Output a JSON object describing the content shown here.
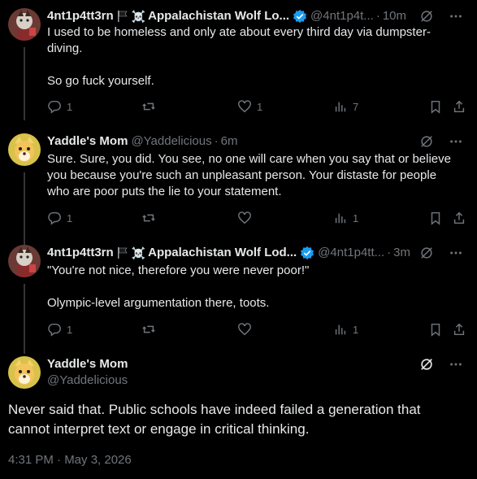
{
  "tweets": [
    {
      "name": "4nt1p4tt3rn",
      "emoji": "🏴‍☠️",
      "display_suffix": "Appalachistan Wolf Lo...",
      "handle": "@4nt1p4t...",
      "time": "10m",
      "lines": [
        "I used to be homeless and only ate about every third day via dumpster-",
        "diving.",
        "",
        "So go fuck yourself."
      ],
      "replies": "1",
      "retweets": "",
      "likes": "1",
      "views": "7"
    },
    {
      "name": "Yaddle's Mom",
      "handle": "@Yaddelicious",
      "time": "6m",
      "lines": [
        "Sure. Sure, you did. You see, no one will care when you say that or believe",
        "you because you're such an unpleasant person. Your distaste for people",
        "who are poor puts the lie to your statement."
      ],
      "replies": "1",
      "retweets": "",
      "likes": "",
      "views": "1"
    },
    {
      "name": "4nt1p4tt3rn",
      "emoji": "🏴‍☠️",
      "display_suffix": "Appalachistan Wolf Lod...",
      "handle": "@4nt1p4tt...",
      "time": "3m",
      "lines": [
        "\"You're not nice, therefore you were never poor!\"",
        "",
        "Olympic-level argumentation there, toots."
      ],
      "replies": "1",
      "retweets": "",
      "likes": "",
      "views": "1"
    }
  ],
  "focus": {
    "name": "Yaddle's Mom",
    "handle": "@Yaddelicious",
    "lines": [
      "Never said that. Public schools have indeed failed a generation that",
      "cannot interpret text or engage in critical thinking."
    ],
    "timestamp": "4:31 PM · May 3, 2026"
  },
  "icons": [
    "reply-icon",
    "retweet-icon",
    "like-icon",
    "views-icon",
    "bookmark-icon",
    "share-icon",
    "grok-icon",
    "more-icon",
    "verified-badge-icon",
    "black-flag-icon"
  ],
  "colors": {
    "background": "#000000",
    "text": "#e7e9ea",
    "muted": "#71767b",
    "verified": "#1d9bf0",
    "line": "#333639"
  }
}
